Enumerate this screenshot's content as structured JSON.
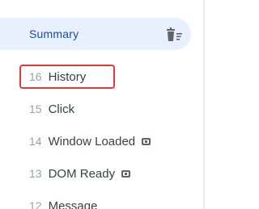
{
  "summary": {
    "label": "Summary",
    "clear_icon": "clear-all-icon"
  },
  "events": [
    {
      "number": "16",
      "label": "History",
      "badge": null,
      "selected": true
    },
    {
      "number": "15",
      "label": "Click",
      "badge": null,
      "selected": false
    },
    {
      "number": "14",
      "label": "Window Loaded",
      "badge": "code-icon",
      "selected": false
    },
    {
      "number": "13",
      "label": "DOM Ready",
      "badge": "code-icon",
      "selected": false
    },
    {
      "number": "12",
      "label": "Message",
      "badge": null,
      "selected": false
    }
  ],
  "colors": {
    "summary_bg": "#e8f0fe",
    "summary_text": "#174ea6",
    "selection_outline": "#e53935"
  }
}
